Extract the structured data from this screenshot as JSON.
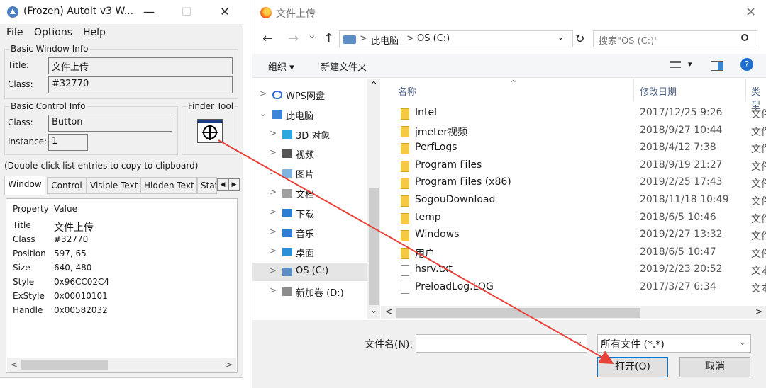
{
  "autoit": {
    "title": "(Frozen) AutoIt v3 W...",
    "window_controls": {
      "minimize": "—",
      "maximize": "☐",
      "close": "✕"
    },
    "menu": [
      "File",
      "Options",
      "Help"
    ],
    "basic_window_info": {
      "legend": "Basic Window Info",
      "title_label": "Title:",
      "title_value": "文件上传",
      "class_label": "Class:",
      "class_value": "#32770"
    },
    "basic_control_info": {
      "legend": "Basic Control Info",
      "class_label": "Class:",
      "class_value": "Button",
      "instance_label": "Instance:",
      "instance_value": "1"
    },
    "finder_tool": {
      "legend": "Finder Tool",
      "icon": "crosshair-target-icon"
    },
    "hint": "(Double-click list entries to copy to clipboard)",
    "tabs": [
      "Window",
      "Control",
      "Visible Text",
      "Hidden Text",
      "Stat"
    ],
    "active_tab": "Window",
    "tab_scroll": {
      "left": "◀",
      "right": "▶"
    },
    "list_header": {
      "property": "Property",
      "value": "Value"
    },
    "properties": [
      {
        "k": "Title",
        "v": "文件上传"
      },
      {
        "k": "Class",
        "v": "#32770"
      },
      {
        "k": "Position",
        "v": "597, 65"
      },
      {
        "k": "Size",
        "v": "640, 480"
      },
      {
        "k": "Style",
        "v": "0x96CC02C4"
      },
      {
        "k": "ExStyle",
        "v": "0x00010101"
      },
      {
        "k": "Handle",
        "v": "0x00582032"
      }
    ],
    "scroll_arrows": {
      "left": "<",
      "right": ">"
    }
  },
  "dialog": {
    "title": "文件上传",
    "close": "✕",
    "nav": {
      "back": "←",
      "forward": "→",
      "recent": "⌄",
      "up": "↑"
    },
    "breadcrumb": [
      "此电脑",
      "OS (C:)"
    ],
    "breadcrumb_sep": ">",
    "address_dropdown": "⌄",
    "refresh": "↻",
    "search_placeholder": "搜索\"OS (C:)\"",
    "toolbar": {
      "organize": "组织 ▾",
      "new_folder": "新建文件夹",
      "view_menu": "▾",
      "help": "?"
    },
    "nav_tree": [
      {
        "label": "WPS网盘",
        "expander": ">",
        "icon": "cloud-icon",
        "color": "#2c6fd1"
      },
      {
        "label": "此电脑",
        "expander": "⌄",
        "icon": "computer-icon",
        "color": "#3b86d8"
      },
      {
        "label": "3D 对象",
        "expander": ">",
        "icon": "3d-objects-icon",
        "color": "#2da7df"
      },
      {
        "label": "视频",
        "expander": ">",
        "icon": "video-icon",
        "color": "#555555"
      },
      {
        "label": "图片",
        "expander": ">",
        "icon": "pictures-icon",
        "color": "#7fb3e0"
      },
      {
        "label": "文档",
        "expander": ">",
        "icon": "documents-icon",
        "color": "#a0a0a0"
      },
      {
        "label": "下载",
        "expander": ">",
        "icon": "downloads-icon",
        "color": "#2d7fd3"
      },
      {
        "label": "音乐",
        "expander": ">",
        "icon": "music-icon",
        "color": "#2d7fd3"
      },
      {
        "label": "桌面",
        "expander": ">",
        "icon": "desktop-icon",
        "color": "#2d8fd8"
      },
      {
        "label": "OS (C:)",
        "expander": ">",
        "icon": "drive-icon",
        "color": "#5b8ec6",
        "selected": true
      },
      {
        "label": "新加卷 (D:)",
        "expander": ">",
        "icon": "drive-icon",
        "color": "#8c8c8c"
      }
    ],
    "scroll_arrows": {
      "up": "^",
      "down": "⌄",
      "left": "<",
      "right": ">"
    },
    "columns": {
      "name": "名称",
      "date": "修改日期",
      "type": "类型"
    },
    "sort_indicator": "^",
    "files": [
      {
        "name": "Intel",
        "date": "2017/12/25 9:26",
        "type": "文件",
        "kind": "folder"
      },
      {
        "name": "jmeter视频",
        "date": "2018/9/27 10:44",
        "type": "文件",
        "kind": "folder"
      },
      {
        "name": "PerfLogs",
        "date": "2018/4/12 7:38",
        "type": "文件",
        "kind": "folder"
      },
      {
        "name": "Program Files",
        "date": "2018/9/19 21:27",
        "type": "文件",
        "kind": "folder"
      },
      {
        "name": "Program Files (x86)",
        "date": "2019/2/25 17:43",
        "type": "文件",
        "kind": "folder"
      },
      {
        "name": "SogouDownload",
        "date": "2018/11/18 10:49",
        "type": "文件",
        "kind": "folder"
      },
      {
        "name": "temp",
        "date": "2018/6/5 10:46",
        "type": "文件",
        "kind": "folder"
      },
      {
        "name": "Windows",
        "date": "2019/2/27 13:32",
        "type": "文件",
        "kind": "folder"
      },
      {
        "name": "用户",
        "date": "2018/6/5 10:47",
        "type": "文件",
        "kind": "folder"
      },
      {
        "name": "hsrv.txt",
        "date": "2019/2/23 20:52",
        "type": "文本",
        "kind": "file"
      },
      {
        "name": "PreloadLog.LOG",
        "date": "2017/3/27 6:34",
        "type": "文本",
        "kind": "file"
      }
    ],
    "filename_label": "文件名(N):",
    "filename_value": "",
    "filename_dropdown": "⌄",
    "filetype_value": "所有文件 (*.*)",
    "filetype_dropdown": "⌄",
    "open_button": "打开(O)",
    "cancel_button": "取消"
  },
  "colors": {
    "annotation_arrow": "#e8413a",
    "accent": "#0078d7"
  }
}
